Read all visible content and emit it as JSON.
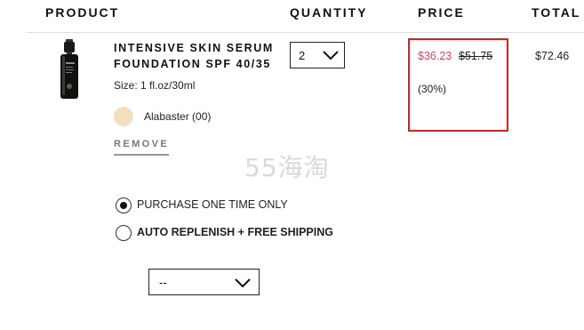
{
  "header": {
    "product": "PRODUCT",
    "quantity": "QUANTITY",
    "price": "PRICE",
    "total": "TOTAL"
  },
  "item": {
    "name": "INTENSIVE SKIN SERUM FOUNDATION SPF 40/35",
    "size": "Size: 1 fl.oz/30ml",
    "shade": "Alabaster (00)",
    "shade_color": "#f2dfbf",
    "remove_label": "REMOVE",
    "quantity": "2",
    "sale_price": "$36.23",
    "original_price": "$51.75",
    "discount": "(30%)",
    "total": "$72.46"
  },
  "purchase_options": {
    "one_time": "PURCHASE ONE TIME ONLY",
    "auto_replenish": "AUTO REPLENISH + FREE SHIPPING",
    "selected": "one_time",
    "frequency_value": "--"
  },
  "watermark": "55海淘",
  "colors": {
    "highlight_box": "#e02020",
    "sale_price": "#e0475a"
  }
}
